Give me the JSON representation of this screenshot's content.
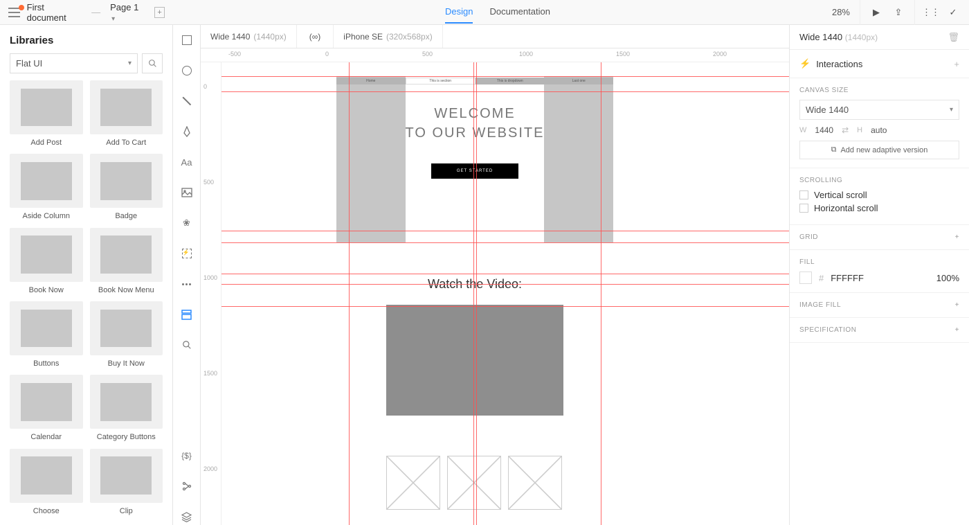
{
  "topbar": {
    "doc_title": "First document",
    "separator": "—",
    "page": "Page 1",
    "tabs": {
      "design": "Design",
      "docs": "Documentation"
    },
    "zoom": "28%"
  },
  "left_panel": {
    "title": "Libraries",
    "selector": "Flat UI",
    "items": [
      {
        "label": "Add Post"
      },
      {
        "label": "Add To Cart"
      },
      {
        "label": "Aside Column"
      },
      {
        "label": "Badge"
      },
      {
        "label": "Book Now"
      },
      {
        "label": "Book Now Menu"
      },
      {
        "label": "Buttons"
      },
      {
        "label": "Buy It Now"
      },
      {
        "label": "Calendar"
      },
      {
        "label": "Category Buttons"
      },
      {
        "label": "Choose"
      },
      {
        "label": "Clip"
      }
    ]
  },
  "breakpoints": {
    "wide": {
      "name": "Wide 1440",
      "px": "(1440px)"
    },
    "inf": "(∞)",
    "iphone": {
      "name": "iPhone SE",
      "px": "(320x568px)"
    }
  },
  "ruler_h": [
    "-500",
    "0",
    "500",
    "1000",
    "1500",
    "2000"
  ],
  "ruler_v": [
    "0",
    "500",
    "1000",
    "1500",
    "2000"
  ],
  "canvas": {
    "nav": [
      "Home",
      "This is section",
      "This is dropdown",
      "Last one"
    ],
    "hero1": "WELCOME",
    "hero2": "TO OUR WEBSITE",
    "cta": "GET STARTED",
    "video_title": "Watch the Video:"
  },
  "inspector": {
    "title": "Wide 1440",
    "title_px": "(1440px)",
    "interactions": "Interactions",
    "canvas_size": {
      "label": "Canvas size",
      "select": "Wide 1440",
      "w_lab": "W",
      "w_val": "1440",
      "h_lab": "H",
      "h_val": "auto",
      "adaptive": "Add new adaptive version"
    },
    "scrolling": {
      "label": "Scrolling",
      "vertical": "Vertical scroll",
      "horizontal": "Horizontal scroll"
    },
    "grid": "Grid",
    "fill": {
      "label": "Fill",
      "hash": "#",
      "hex": "FFFFFF",
      "opacity": "100%"
    },
    "image_fill": "Image Fill",
    "specification": "Specification"
  }
}
